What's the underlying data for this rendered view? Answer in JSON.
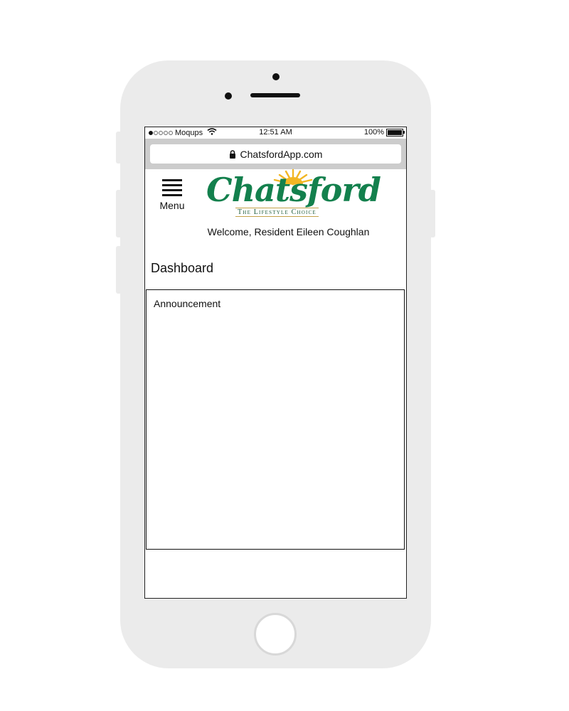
{
  "status_bar": {
    "carrier": "Moqups",
    "time": "12:51 AM",
    "battery": "100%",
    "battery_level": 1.0,
    "signal_dots_filled": 1,
    "icons": [
      "signal-dots-icon",
      "wifi-icon",
      "battery-icon"
    ]
  },
  "browser": {
    "url": "ChatsfordApp.com",
    "icon": "lock-icon"
  },
  "header": {
    "menu_label": "Menu",
    "menu_icon": "hamburger-icon",
    "logo_text": "Chatsford",
    "logo_tagline": "The Lifestyle Choice",
    "welcome": "Welcome, Resident Eileen Coughlan"
  },
  "dashboard": {
    "title": "Dashboard",
    "panel_title": "Announcement"
  },
  "colors": {
    "device": "#ebebeb",
    "address_bar": "#cccccc",
    "logo_green": "#13804d",
    "logo_gold": "#f2b624"
  }
}
